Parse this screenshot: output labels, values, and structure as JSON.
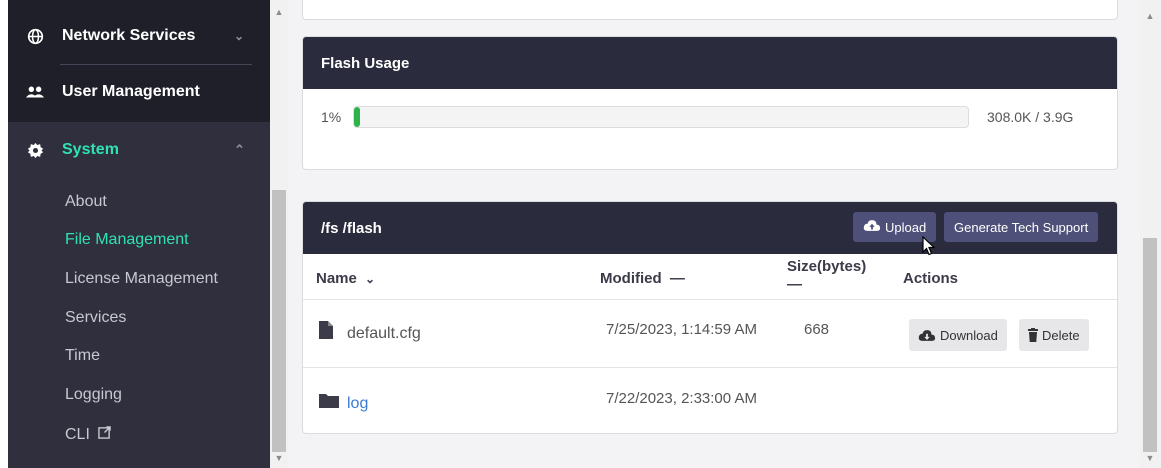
{
  "sidebar": {
    "items": [
      {
        "label": "Network Services",
        "icon": "globe-icon"
      },
      {
        "label": "User Management",
        "icon": "users-icon"
      },
      {
        "label": "System",
        "icon": "gear-icon"
      }
    ],
    "system_subitems": [
      {
        "label": "About"
      },
      {
        "label": "File Management"
      },
      {
        "label": "License Management"
      },
      {
        "label": "Services"
      },
      {
        "label": "Time"
      },
      {
        "label": "Logging"
      },
      {
        "label": "CLI"
      }
    ]
  },
  "flash_usage": {
    "title": "Flash Usage",
    "percent_label": "1%",
    "percent_value": 1,
    "usage_text": "308.0K / 3.9G"
  },
  "file_panel": {
    "path": "/fs /flash",
    "upload_label": "Upload",
    "tech_support_label": "Generate Tech Support",
    "columns": {
      "name": "Name",
      "modified": "Modified",
      "size": "Size(bytes)",
      "actions": "Actions"
    },
    "rows": [
      {
        "name": "default.cfg",
        "type": "file",
        "modified": "7/25/2023, 1:14:59 AM",
        "size": "668",
        "download": "Download",
        "delete": "Delete"
      },
      {
        "name": "log",
        "type": "folder",
        "modified": "7/22/2023, 2:33:00 AM",
        "size": ""
      }
    ]
  },
  "colors": {
    "sidebar_bg": "#2f2f3e",
    "header_bg": "#2a2b3d",
    "accent": "#2fe2b4",
    "progress": "#2db34a",
    "button": "#4e507a",
    "link": "#3a7bd5"
  }
}
